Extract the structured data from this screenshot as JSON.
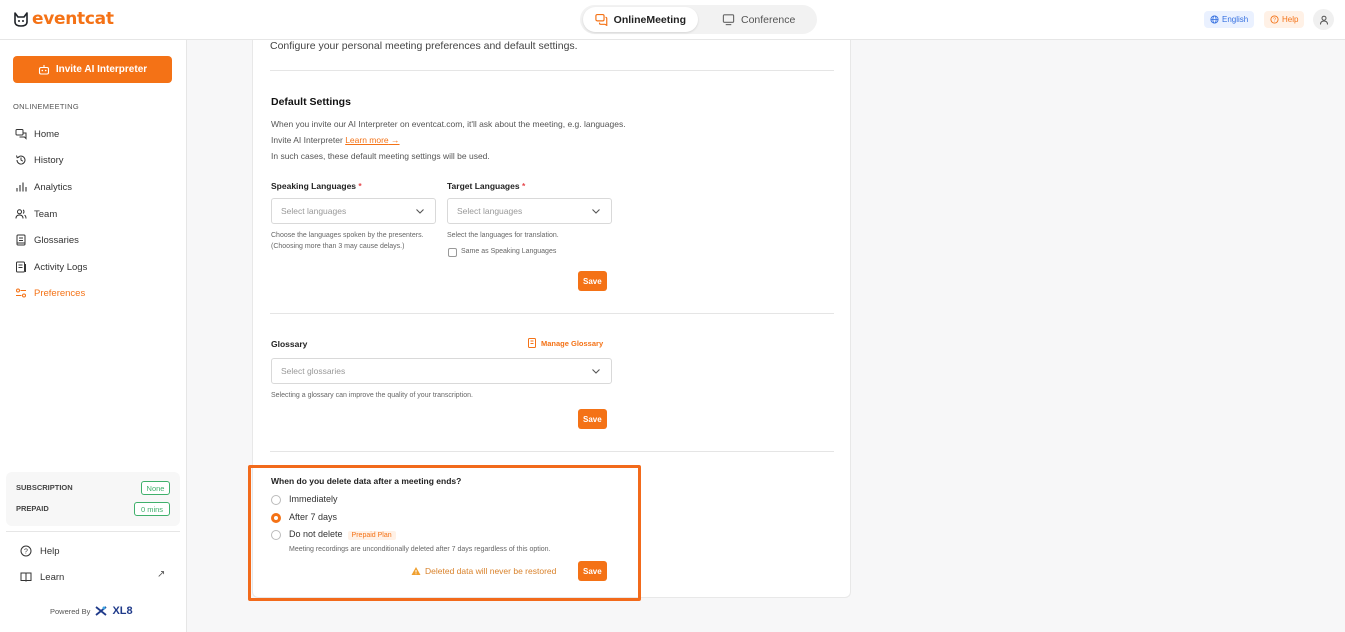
{
  "header": {
    "logo_text": "eventcat",
    "modes": [
      {
        "label": "OnlineMeeting",
        "icon": "chat-icon",
        "active": true
      },
      {
        "label": "Conference",
        "icon": "monitor-icon",
        "active": false
      }
    ],
    "language_label": "English",
    "help_label": "Help"
  },
  "sidebar": {
    "invite_label": "Invite AI Interpreter",
    "section_label": "ONLINEMEETING",
    "items": [
      {
        "label": "Home",
        "icon": "home-chat-icon"
      },
      {
        "label": "History",
        "icon": "history-icon"
      },
      {
        "label": "Analytics",
        "icon": "analytics-icon"
      },
      {
        "label": "Team",
        "icon": "team-icon"
      },
      {
        "label": "Glossaries",
        "icon": "glossary-icon"
      },
      {
        "label": "Activity Logs",
        "icon": "activity-log-icon"
      },
      {
        "label": "Preferences",
        "icon": "preferences-icon",
        "active": true
      }
    ],
    "subscription_label": "SUBSCRIPTION",
    "subscription_value": "None",
    "prepaid_label": "PREPAID",
    "prepaid_value": "0 mins",
    "help_label": "Help",
    "learn_label": "Learn",
    "powered_by": "Powered By",
    "powered_brand": "XL8"
  },
  "main": {
    "intro": "Configure your personal meeting preferences and default settings.",
    "default_settings": {
      "title": "Default Settings",
      "line1": "When you invite our AI Interpreter on eventcat.com, it'll ask about the meeting, e.g. languages.",
      "line2_prefix": "Invite AI Interpreter ",
      "learn_more": "Learn more",
      "line3": "In such cases, these default meeting settings will be used.",
      "speaking_label": "Speaking Languages",
      "speaking_placeholder": "Select languages",
      "speaking_hint": "Choose the languages spoken by the presenters. (Choosing more than 3 may cause delays.)",
      "target_label": "Target Languages",
      "target_placeholder": "Select languages",
      "target_hint": "Select the languages for translation.",
      "same_as_label": "Same as Speaking Languages",
      "required_mark": "*",
      "save_label": "Save"
    },
    "glossary": {
      "title": "Glossary",
      "manage_label": "Manage Glossary",
      "placeholder": "Select glossaries",
      "hint": "Selecting a glossary can improve the quality of your transcription.",
      "save_label": "Save"
    },
    "deletion": {
      "question": "When do you delete data after a meeting ends?",
      "options": [
        {
          "label": "Immediately",
          "selected": false
        },
        {
          "label": "After 7 days",
          "selected": true
        },
        {
          "label": "Do not delete",
          "selected": false,
          "badge": "Prepaid Plan"
        }
      ],
      "note": "Meeting recordings are unconditionally deleted after 7 days regardless of this option.",
      "warning": "Deleted data will never be restored",
      "save_label": "Save"
    }
  },
  "colors": {
    "brand": "#f47216",
    "success": "#3fb06b",
    "highlight": "#f26a1b"
  }
}
